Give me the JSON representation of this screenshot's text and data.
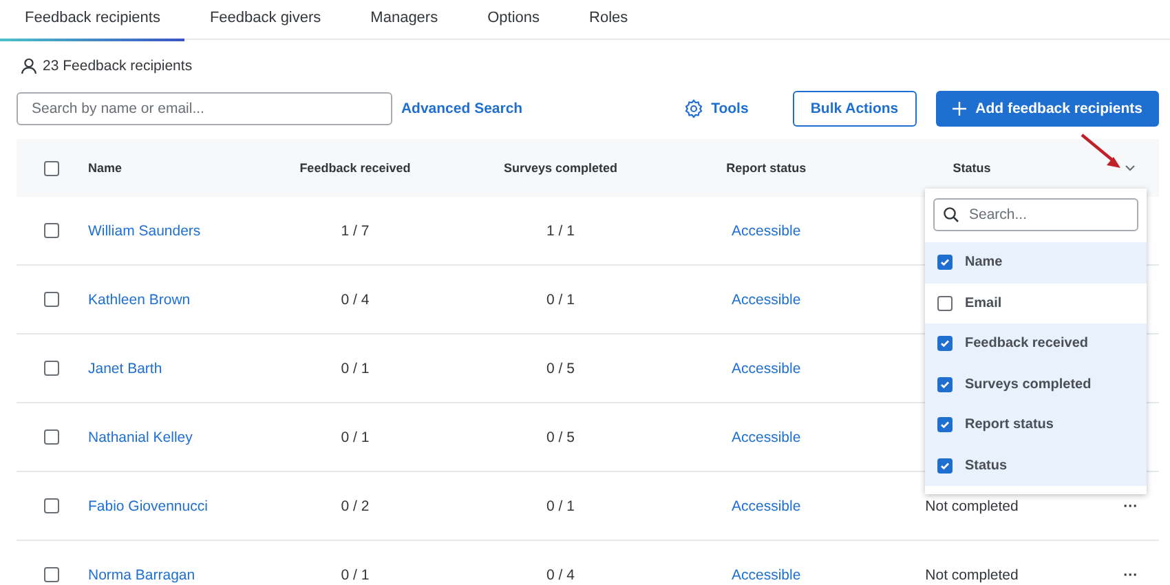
{
  "tabs": [
    {
      "label": "Feedback recipients",
      "selected": true
    },
    {
      "label": "Feedback givers",
      "selected": false
    },
    {
      "label": "Managers",
      "selected": false
    },
    {
      "label": "Options",
      "selected": false
    },
    {
      "label": "Roles",
      "selected": false
    }
  ],
  "count": "23 Feedback recipients",
  "search": {
    "placeholder": "Search by name or email..."
  },
  "advanced_search": "Advanced Search",
  "tools": "Tools",
  "bulk_actions": "Bulk Actions",
  "add_button": "Add feedback recipients",
  "table": {
    "select_all": {
      "checked": false
    },
    "columns": [
      "Name",
      "Feedback received",
      "Surveys completed",
      "Report status",
      "Status"
    ],
    "rows": [
      {
        "checked": false,
        "name": "William Saunders",
        "feedback": "1 / 7",
        "surveys": "1 / 1",
        "report": "Accessible"
      },
      {
        "checked": false,
        "name": "Kathleen Brown",
        "feedback": "0 / 4",
        "surveys": "0 / 1",
        "report": "Accessible"
      },
      {
        "checked": false,
        "name": "Janet Barth",
        "feedback": "0 / 1",
        "surveys": "0 / 5",
        "report": "Accessible"
      },
      {
        "checked": false,
        "name": "Nathanial Kelley",
        "feedback": "0 / 1",
        "surveys": "0 / 5",
        "report": "Accessible"
      },
      {
        "checked": false,
        "name": "Fabio Giovennucci",
        "feedback": "0 / 2",
        "surveys": "0 / 1",
        "report": "Accessible",
        "status": "Not completed",
        "more": "···"
      },
      {
        "checked": false,
        "name": "Norma Barragan",
        "feedback": "0 / 1",
        "surveys": "0 / 4",
        "report": "Accessible",
        "status": "Not completed",
        "more": "···"
      }
    ]
  },
  "column_menu": {
    "search": {
      "placeholder": "Search..."
    },
    "items": [
      {
        "label": "Name",
        "checked": true
      },
      {
        "label": "Email",
        "checked": false
      },
      {
        "label": "Feedback received",
        "checked": true
      },
      {
        "label": "Surveys completed",
        "checked": true
      },
      {
        "label": "Report status",
        "checked": true
      },
      {
        "label": "Status",
        "checked": true
      }
    ]
  }
}
